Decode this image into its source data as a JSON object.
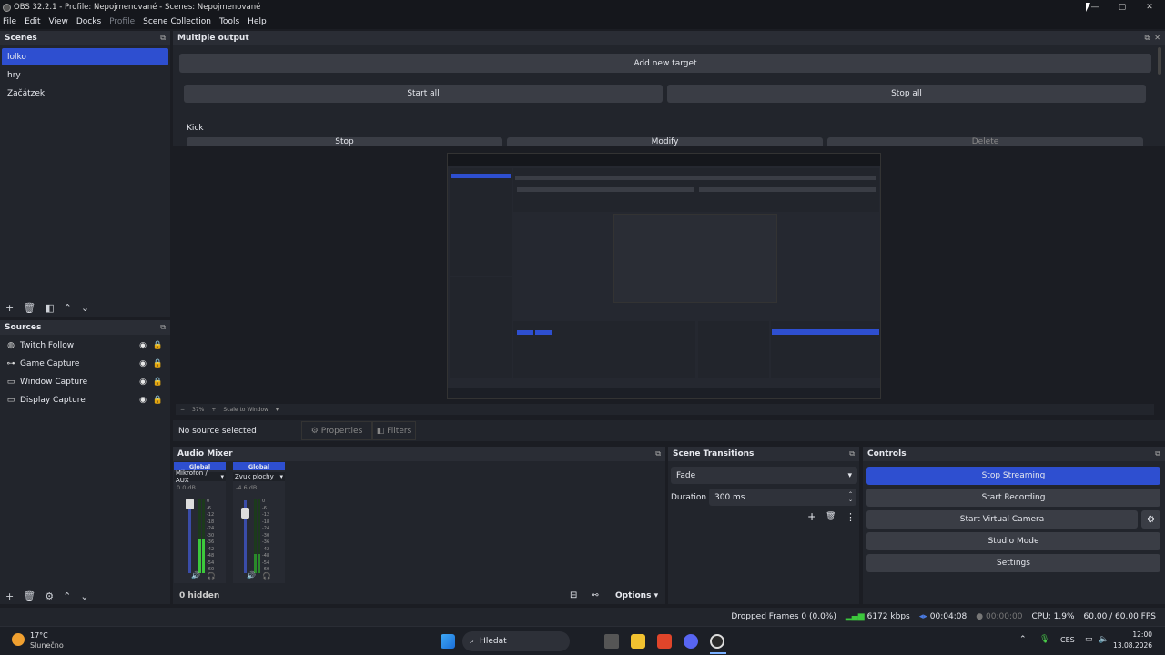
{
  "window": {
    "title": "OBS 32.2.1 - Profile: Nepojmenované - Scenes: Nepojmenované"
  },
  "menu": [
    "File",
    "Edit",
    "View",
    "Docks",
    "Profile",
    "Scene Collection",
    "Tools",
    "Help"
  ],
  "scenes": {
    "title": "Scenes",
    "items": [
      "lolko",
      "hry",
      "Začátzek"
    ],
    "selected": 0
  },
  "sources": {
    "title": "Sources",
    "items": [
      {
        "name": "Twitch Follow",
        "icon": "globe-icon"
      },
      {
        "name": "Game Capture",
        "icon": "gamepad-icon"
      },
      {
        "name": "Window Capture",
        "icon": "window-icon"
      },
      {
        "name": "Display Capture",
        "icon": "monitor-icon"
      }
    ]
  },
  "multiple_output": {
    "title": "Multiple output",
    "add_target": "Add new target",
    "start_all": "Start all",
    "stop_all": "Stop all",
    "target_name": "Kick",
    "stop": "Stop",
    "modify": "Modify",
    "delete": "Delete"
  },
  "preview": {
    "zoom": "37%",
    "scale": "Scale to Window"
  },
  "context": {
    "no_source": "No source selected",
    "properties": "Properties",
    "filters": "Filters"
  },
  "audio_mixer": {
    "title": "Audio Mixer",
    "channels": [
      {
        "group": "Global",
        "name": "Mikrofon / AUX",
        "db": "0.0 dB",
        "level": 0.45
      },
      {
        "group": "Global",
        "name": "Zvuk plochy",
        "db": "-4.6 dB",
        "level": 0.25
      }
    ],
    "scale": [
      "0",
      "-6",
      "-12",
      "-18",
      "-24",
      "-30",
      "-36",
      "-42",
      "-48",
      "-54",
      "-60"
    ],
    "hidden": "0 hidden",
    "options": "Options"
  },
  "scene_transitions": {
    "title": "Scene Transitions",
    "transition": "Fade",
    "duration_label": "Duration",
    "duration": "300 ms"
  },
  "controls": {
    "title": "Controls",
    "stop_streaming": "Stop Streaming",
    "start_recording": "Start Recording",
    "start_virtual_camera": "Start Virtual Camera",
    "studio_mode": "Studio Mode",
    "settings": "Settings"
  },
  "status": {
    "dropped": "Dropped Frames 0 (0.0%)",
    "kbps": "6172 kbps",
    "stream_time": "00:04:08",
    "rec_time": "00:00:00",
    "cpu": "CPU: 1.9%",
    "fps": "60.00 / 60.00 FPS"
  },
  "taskbar": {
    "weather_temp": "17°C",
    "weather_desc": "Slunečno",
    "search": "Hledat",
    "lang": "CES",
    "time": "12:00",
    "date": "13.08.2026"
  },
  "colors": {
    "accent": "#2e4fd0",
    "bg": "#1b1d23",
    "panel": "#22252c"
  }
}
